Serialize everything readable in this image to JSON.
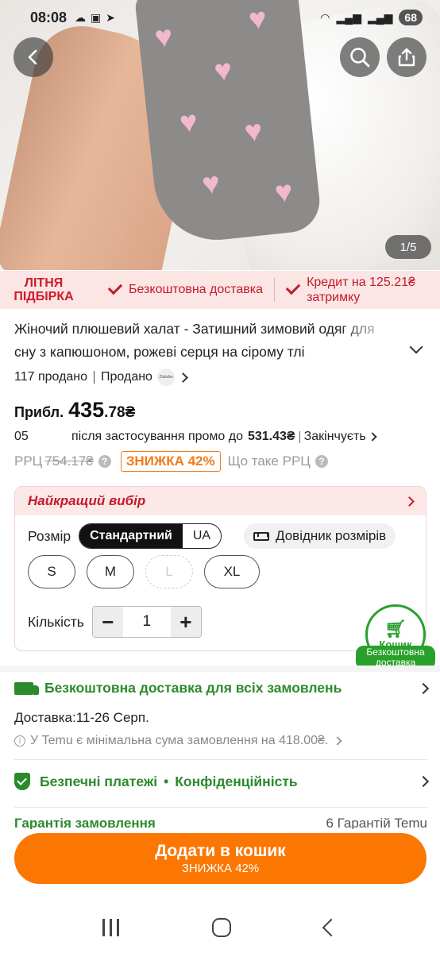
{
  "status_bar": {
    "time": "08:08",
    "battery": "68",
    "icons": [
      "cloud-icon",
      "screenshot-icon",
      "telegram-icon",
      "wifi-icon",
      "signal-icon",
      "signal-icon"
    ]
  },
  "gallery": {
    "indicator": "1/5"
  },
  "promo_strip": {
    "label_line1": "ЛІТНЯ",
    "label_line2": "ПІДБІРКА",
    "free_shipping": "Безкоштовна доставка",
    "credit_line1": "Кредит на 125.21₴",
    "credit_line2": "затримку"
  },
  "product": {
    "title": "Жіночий плюшевий халат - Затишний зимовий одяг для сну з капюшоном, рожеві серця на сірому тлі",
    "sold": "117 продано",
    "seller_prefix": "Продано",
    "brand_logo_text": "Zlabdiw"
  },
  "price": {
    "prefix": "Прибл.",
    "integer": "435",
    "decimal": ".78₴",
    "countdown": "05",
    "promo_text": "після застосування промо до",
    "promo_amount": "531.43₴",
    "ending": "Закінчуєть",
    "rrc_label": "РРЦ",
    "rrc_old": "754.17₴",
    "discount": "ЗНИЖКА 42%",
    "rrc_help": "Що таке РРЦ"
  },
  "options": {
    "best_choice": "Найкращий вибір",
    "size_label": "Розмір",
    "size_standards": [
      "Стандартний",
      "UA"
    ],
    "size_guide": "Довідник розмірів",
    "sizes": [
      "S",
      "M",
      "L",
      "XL"
    ],
    "quantity_label": "Кількість",
    "quantity": "1",
    "cart_label": "Кошик",
    "free_delivery_badge_line1": "Безкоштовна",
    "free_delivery_badge_line2": "доставка"
  },
  "shipping": {
    "title": "Безкоштовна доставка для всіх замовлень",
    "delivery_label": "Доставка:",
    "delivery_dates": "11-26 Серп.",
    "min_order": "У Temu є мінімальна сума замовлення на 418.00₴."
  },
  "security": {
    "payments": "Безпечні платежі",
    "privacy": "Конфіденційність"
  },
  "guarantee": {
    "left": "Гарантія замовлення",
    "right": "6 Гарантій Temu"
  },
  "cta": {
    "main": "Додати в кошик",
    "sub": "ЗНИЖКА 42%"
  },
  "colors": {
    "accent": "#fb7701",
    "green": "#2b8a2b",
    "red": "#c41a28",
    "cart_green": "#29a02a"
  }
}
